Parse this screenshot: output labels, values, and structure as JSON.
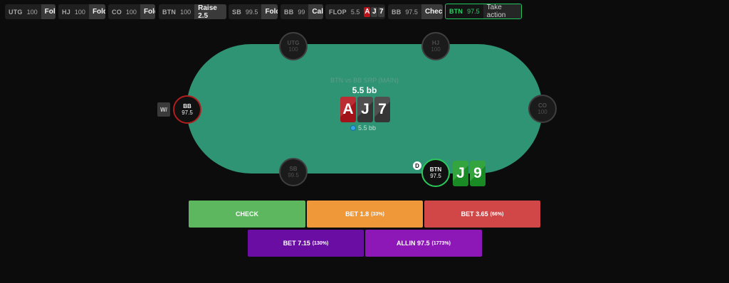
{
  "history": [
    {
      "pos": "UTG",
      "stack": "100",
      "action": "Fold"
    },
    {
      "pos": "HJ",
      "stack": "100",
      "action": "Fold"
    },
    {
      "pos": "CO",
      "stack": "100",
      "action": "Fold"
    },
    {
      "pos": "BTN",
      "stack": "100",
      "action": "Raise 2.5"
    },
    {
      "pos": "SB",
      "stack": "99.5",
      "action": "Fold"
    },
    {
      "pos": "BB",
      "stack": "99",
      "action": "Call"
    },
    {
      "pos": "FLOP",
      "stack": "5.5",
      "cards": [
        {
          "rank": "A",
          "color": "red"
        },
        {
          "rank": "J",
          "color": "dark"
        },
        {
          "rank": "7",
          "color": "dark"
        }
      ]
    },
    {
      "pos": "BB",
      "stack": "97.5",
      "action": "Check"
    },
    {
      "pos": "BTN",
      "stack": "97.5",
      "action": "Take action",
      "current": true
    }
  ],
  "table": {
    "pot_label": "BTN vs BB SRP (MAIN)",
    "pot_amount": "5.5 bb",
    "board": [
      {
        "rank": "A",
        "color": "red"
      },
      {
        "rank": "J",
        "color": "dark"
      },
      {
        "rank": "7",
        "color": "dark"
      }
    ],
    "pot_chips": "5.5 bb",
    "dealer": "D",
    "tag": "W/"
  },
  "seats": {
    "utg": {
      "name": "UTG",
      "stack": "100"
    },
    "hj": {
      "name": "HJ",
      "stack": "100"
    },
    "co": {
      "name": "CO",
      "stack": "100"
    },
    "bb": {
      "name": "BB",
      "stack": "97.5"
    },
    "sb": {
      "name": "SB",
      "stack": "99.5"
    },
    "btn": {
      "name": "BTN",
      "stack": "97.5"
    }
  },
  "hero_cards": [
    {
      "rank": "J",
      "color": "green"
    },
    {
      "rank": "9",
      "color": "green"
    }
  ],
  "actions": {
    "check": {
      "label": "CHECK"
    },
    "bet1": {
      "label": "BET 1.8",
      "pct": "(33%)"
    },
    "bet2": {
      "label": "BET 3.65",
      "pct": "(66%)"
    },
    "bet3": {
      "label": "BET 7.15",
      "pct": "(130%)"
    },
    "allin": {
      "label": "ALLIN 97.5",
      "pct": "(1773%)"
    }
  },
  "colors": {
    "felt": "#2f9474",
    "check": "#5cb75f",
    "bet_small": "#ee983a",
    "bet_mid": "#d14747",
    "bet_big": "#6a0ea3",
    "allin": "#8d17b7",
    "current_outline": "#22c55e"
  }
}
